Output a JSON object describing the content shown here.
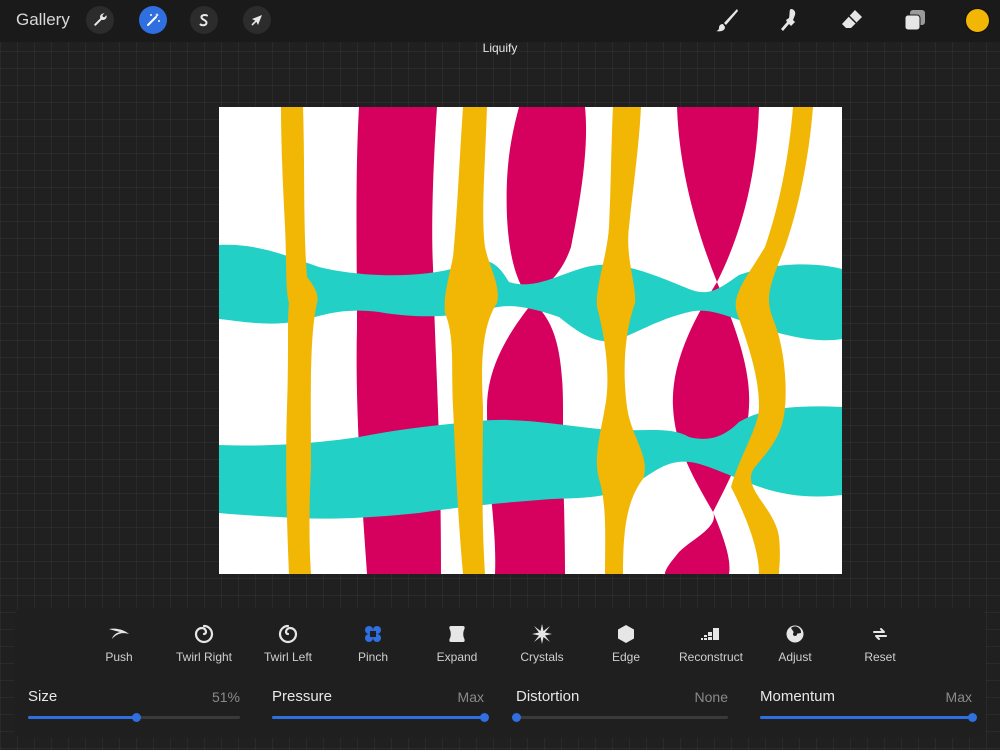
{
  "top_bar": {
    "gallery_label": "Gallery",
    "left_tools": [
      {
        "name": "actions",
        "icon": "wrench-icon"
      },
      {
        "name": "adjustments",
        "icon": "magic-wand-icon",
        "active": true
      },
      {
        "name": "selection",
        "icon": "selection-s-icon"
      },
      {
        "name": "transform",
        "icon": "arrow-cursor-icon"
      }
    ],
    "right_tools": [
      {
        "name": "brush",
        "icon": "brush-icon"
      },
      {
        "name": "smudge",
        "icon": "smudge-icon"
      },
      {
        "name": "eraser",
        "icon": "eraser-icon"
      },
      {
        "name": "layers",
        "icon": "layers-icon"
      }
    ],
    "current_color": "#f2b705"
  },
  "mode_title": "Liquify",
  "canvas_colors": {
    "yellow": "#f2b705",
    "magenta": "#d6005e",
    "teal": "#22d0c6",
    "background": "#ffffff"
  },
  "liquify_modes": [
    {
      "label": "Push",
      "icon": "push-icon"
    },
    {
      "label": "Twirl Right",
      "icon": "twirl-right-icon"
    },
    {
      "label": "Twirl Left",
      "icon": "twirl-left-icon"
    },
    {
      "label": "Pinch",
      "icon": "pinch-icon",
      "active": true
    },
    {
      "label": "Expand",
      "icon": "expand-icon"
    },
    {
      "label": "Crystals",
      "icon": "crystals-icon"
    },
    {
      "label": "Edge",
      "icon": "edge-icon"
    },
    {
      "label": "Reconstruct",
      "icon": "reconstruct-icon"
    },
    {
      "label": "Adjust",
      "icon": "adjust-icon"
    },
    {
      "label": "Reset",
      "icon": "reset-icon"
    }
  ],
  "sliders": [
    {
      "label": "Size",
      "value": "51%",
      "fraction": 0.51
    },
    {
      "label": "Pressure",
      "value": "Max",
      "fraction": 1.0
    },
    {
      "label": "Distortion",
      "value": "None",
      "fraction": 0.0
    },
    {
      "label": "Momentum",
      "value": "Max",
      "fraction": 1.0
    }
  ],
  "accent_color": "#2f6fe0"
}
